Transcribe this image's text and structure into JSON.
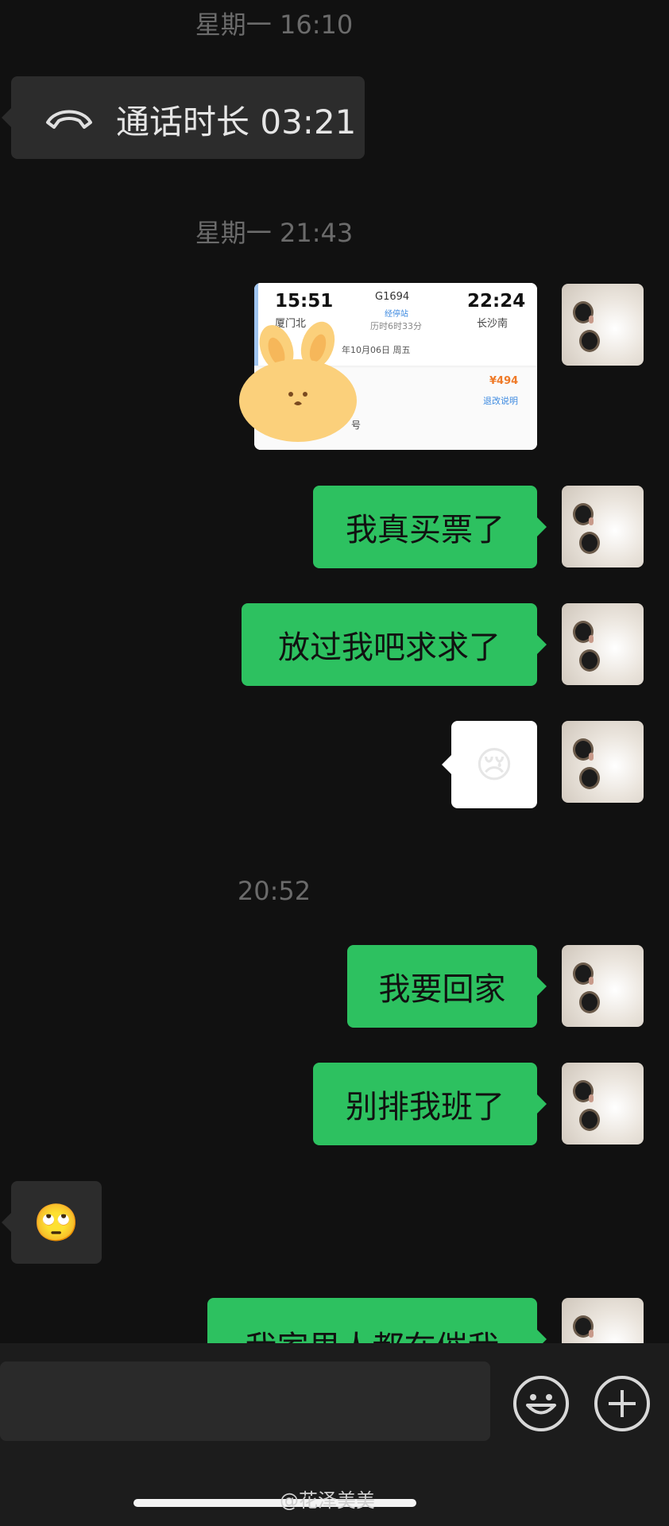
{
  "timestamps": {
    "t1": "星期一 16:10",
    "t2": "星期一 21:43",
    "t3": "20:52"
  },
  "call": {
    "label": "通话时长 03:21",
    "icon": "phone-hangup-icon"
  },
  "ticket": {
    "depart_time": "15:51",
    "train_no": "G1694",
    "arrive_time": "22:24",
    "depart_station": "厦门北",
    "via_label": "经停站",
    "arrive_station": "长沙南",
    "duration": "历时6时33分",
    "date": "年10月06日 周五",
    "price": "¥494",
    "refund_link": "退改说明",
    "seat_fragment": "号"
  },
  "messages": {
    "m1": "我真买票了",
    "m2": "放过我吧求求了",
    "m3": "我要回家",
    "m4": "别排我班了",
    "m5": "我家里人都在催我"
  },
  "emojis": {
    "cry": "😢",
    "eyeroll": "🙄"
  },
  "input": {
    "emoji_icon": "smiley-icon",
    "plus_icon": "plus-icon"
  },
  "watermark": "@花泽美美"
}
